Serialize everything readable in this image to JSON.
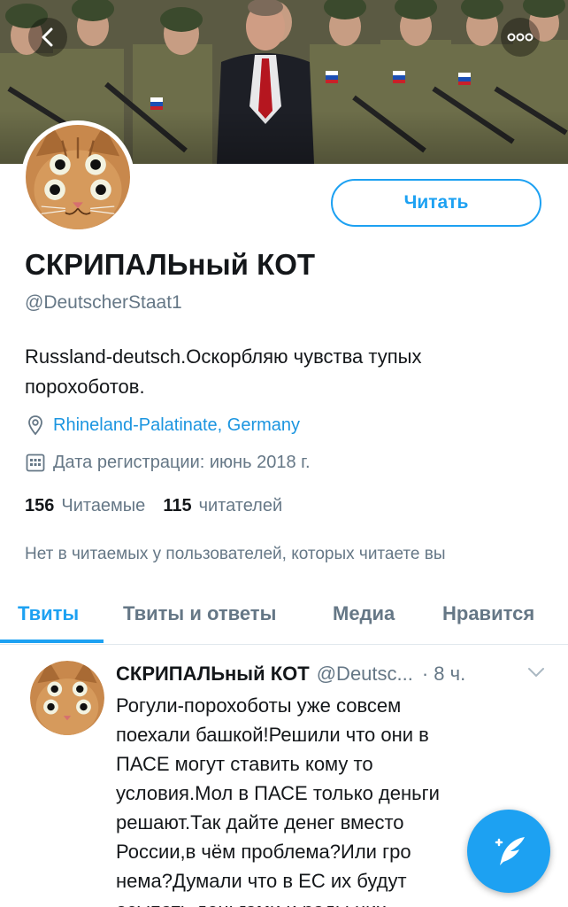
{
  "header": {
    "back_icon": "chevron-left-icon",
    "more_icon": "more-dots-icon"
  },
  "profile": {
    "follow_label": "Читать",
    "name": "СКРИПАЛЬный КОТ",
    "handle": "@DeutscherStaat1",
    "bio": "Russland-deutsch.Оскорбляю чувства тупых порохоботов.",
    "location": "Rhineland-Palatinate, Germany",
    "joined": "Дата регистрации: июнь 2018 г.",
    "following_count": "156",
    "following_label": "Читаемые",
    "followers_count": "115",
    "followers_label": "читателей",
    "mutual_note": "Нет в читаемых у пользователей, которых читаете вы"
  },
  "tabs": [
    {
      "label": "Твиты",
      "active": true
    },
    {
      "label": "Твиты и ответы",
      "active": false
    },
    {
      "label": "Медиа",
      "active": false
    },
    {
      "label": "Нравится",
      "active": false
    }
  ],
  "tweet": {
    "name": "СКРИПАЛЬный КОТ",
    "handle": "@Deutsc...",
    "time": "· 8 ч.",
    "lines": [
      "Рогули-порохоботы уже совсем",
      "поехали башкой!Решили что они в",
      "ПАСЕ могут ставить кому то",
      "условия.Мол в ПАСЕ только деньги",
      "решают.Так дайте денег вместо",
      "России,в чём проблема?Или гро",
      "нема?Думали что в ЕС их будут",
      "осыпать деньгами и рады них"
    ]
  },
  "fab": {
    "icon": "compose-tweet-icon"
  },
  "colors": {
    "accent": "#1da1f2",
    "secondary_text": "#657786",
    "link": "#1b95e0"
  }
}
